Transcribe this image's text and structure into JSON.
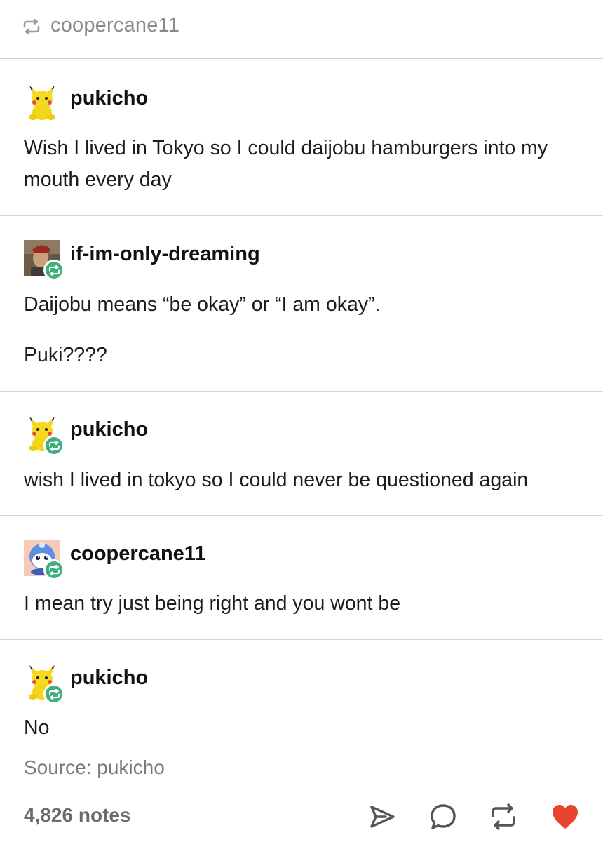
{
  "header": {
    "reblog_user": "coopercane11",
    "icon": "reblog-icon"
  },
  "posts": [
    {
      "username": "pukicho",
      "avatar": "pikachu-plush",
      "reblog_badge": false,
      "text": "Wish I lived in Tokyo so I could daijobu hamburgers into my mouth every day"
    },
    {
      "username": "if-im-only-dreaming",
      "avatar": "photo-portrait",
      "reblog_badge": true,
      "text": "Daijobu means “be okay” or “I am okay”.",
      "text2": "Puki????"
    },
    {
      "username": "pukicho",
      "avatar": "pikachu-plush",
      "reblog_badge": true,
      "text": "wish I lived in tokyo so I could never be questioned again"
    },
    {
      "username": "coopercane11",
      "avatar": "round-blue-character",
      "reblog_badge": true,
      "text": "I mean try just being right and you wont be"
    },
    {
      "username": "pukicho",
      "avatar": "pikachu-plush",
      "reblog_badge": true,
      "text": "No"
    }
  ],
  "footer": {
    "source": "Source: pukicho",
    "notes": "4,826 notes",
    "actions": [
      "share-icon",
      "reply-icon",
      "reblog-icon",
      "like-heart-icon"
    ],
    "colors": {
      "reblog_badge": "#3fb07d",
      "like": "#e8432f",
      "muted": "#7a7a7a"
    }
  }
}
